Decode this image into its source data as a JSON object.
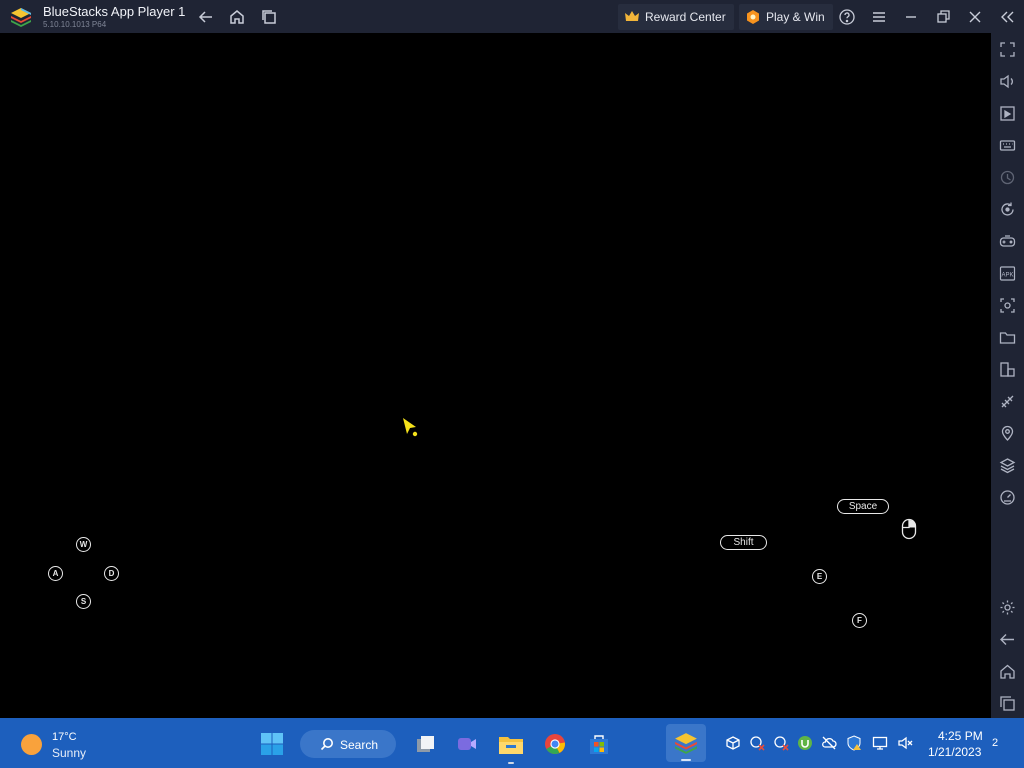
{
  "titlebar": {
    "app_title": "BlueStacks App Player 1",
    "version": "5.10.10.1013  P64",
    "reward_center": "Reward Center",
    "play_win": "Play & Win"
  },
  "keymap": {
    "w": "W",
    "a": "A",
    "s": "S",
    "d": "D",
    "space": "Space",
    "shift": "Shift",
    "e": "E",
    "f": "F"
  },
  "sidebar_icons": [
    "fullscreen-icon",
    "volume-icon",
    "screen-record-icon",
    "keyboard-icon",
    "macro-icon",
    "rotate-icon",
    "gamepad-icon",
    "apk-icon",
    "screenshot-icon",
    "folder-icon",
    "multi-instance-icon",
    "eco-mode-icon",
    "location-icon",
    "layers-icon",
    "performance-icon",
    "settings-icon",
    "back-icon",
    "home-icon",
    "recent-apps-icon"
  ],
  "taskbar": {
    "temperature": "17°C",
    "condition": "Sunny",
    "search_label": "Search",
    "time": "4:25 PM",
    "date": "1/21/2023",
    "notification_count": "2"
  },
  "colors": {
    "titlebar_bg": "#1f2434",
    "taskbar_bg": "#1d5fbd",
    "cursor_yellow": "#f5e21b",
    "crown_gold": "#f2b53a",
    "play_win_orange": "#f7931e"
  }
}
